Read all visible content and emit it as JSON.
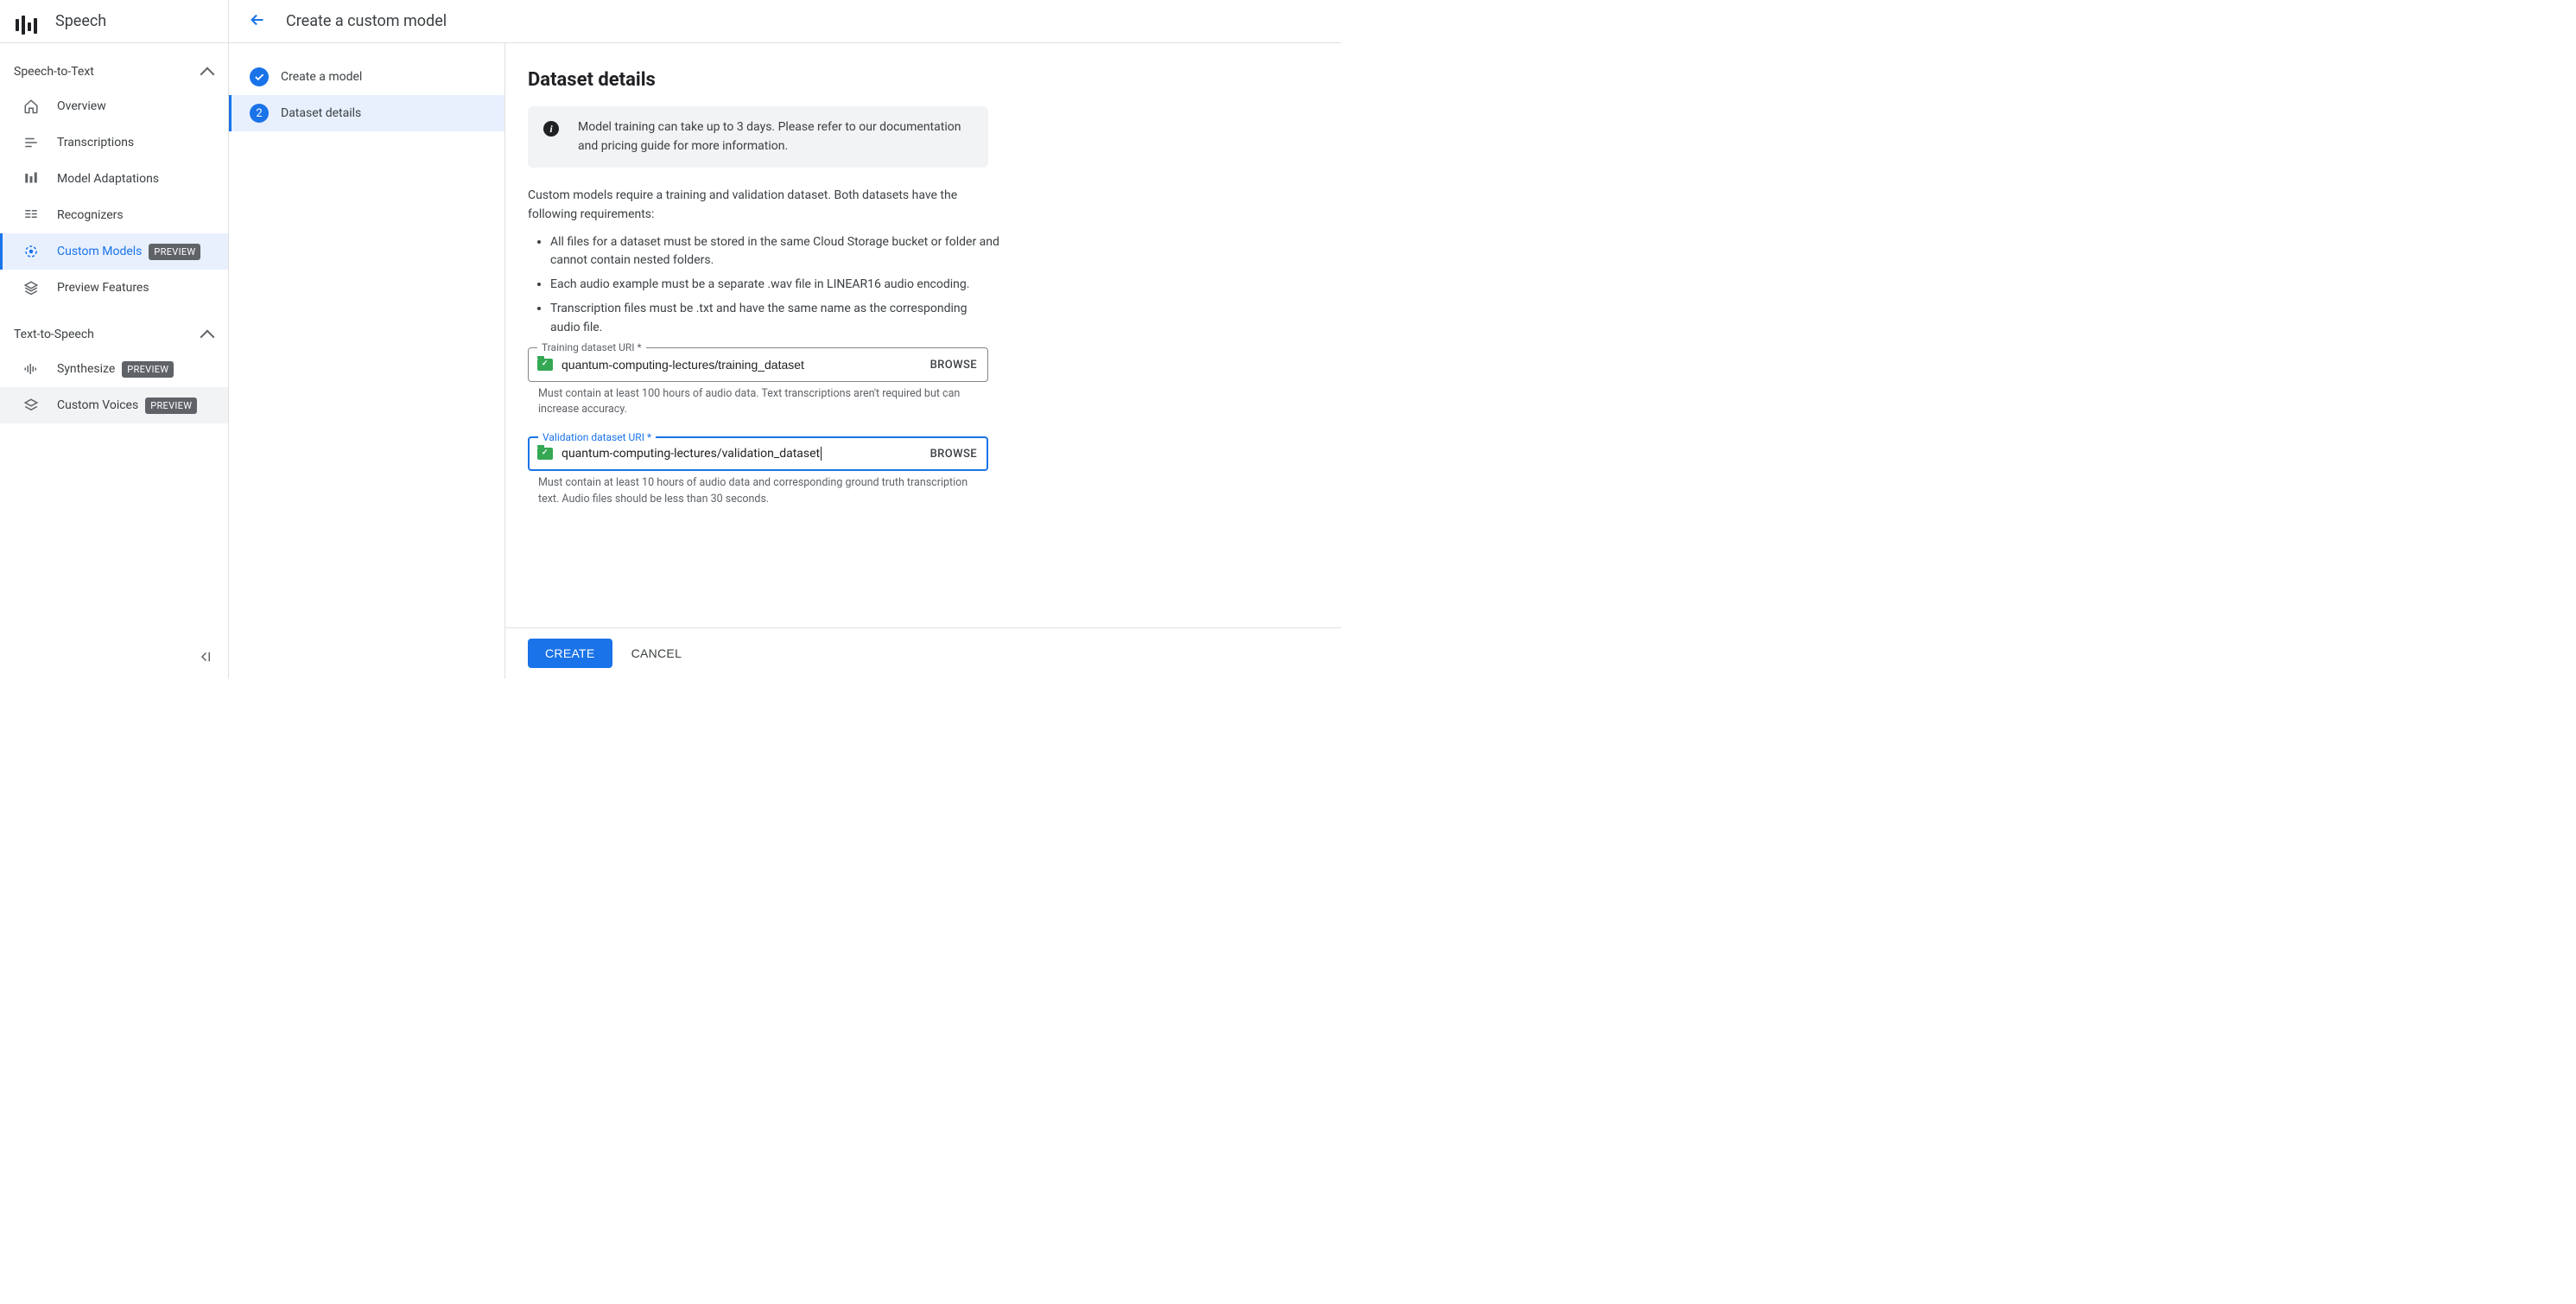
{
  "sidebar": {
    "title": "Speech",
    "sections": [
      {
        "label": "Speech-to-Text",
        "items": [
          {
            "label": "Overview",
            "icon": "home"
          },
          {
            "label": "Transcriptions",
            "icon": "transcriptions"
          },
          {
            "label": "Model Adaptations",
            "icon": "adaptations"
          },
          {
            "label": "Recognizers",
            "icon": "recognizers"
          },
          {
            "label": "Custom Models",
            "icon": "custom-models",
            "badge": "PREVIEW",
            "selected": true
          },
          {
            "label": "Preview Features",
            "icon": "preview"
          }
        ]
      },
      {
        "label": "Text-to-Speech",
        "items": [
          {
            "label": "Synthesize",
            "icon": "synthesize",
            "badge": "PREVIEW"
          },
          {
            "label": "Custom Voices",
            "icon": "voices",
            "badge": "PREVIEW",
            "hover": true
          }
        ]
      }
    ]
  },
  "header": {
    "title": "Create a custom model"
  },
  "stepper": {
    "steps": [
      {
        "label": "Create a model",
        "state": "done"
      },
      {
        "label": "Dataset details",
        "state": "active",
        "number": "2"
      }
    ]
  },
  "content": {
    "title": "Dataset details",
    "banner": "Model training can take up to 3 days. Please refer to our documentation and pricing guide for more information.",
    "intro": "Custom models require a training and validation dataset. Both datasets have the following requirements:",
    "requirements": [
      "All files for a dataset must be stored in the same Cloud Storage bucket or folder and cannot contain nested folders.",
      "Each audio example must be a separate .wav file in LINEAR16 audio encoding.",
      "Transcription files must be .txt and have the same name as the corresponding audio file."
    ],
    "training": {
      "label": "Training dataset URI *",
      "value": "quantum-computing-lectures/training_dataset",
      "browse": "BROWSE",
      "helper": "Must contain at least 100 hours of audio data. Text transcriptions aren't required but can increase accuracy."
    },
    "validation": {
      "label": "Validation dataset URI *",
      "value": "quantum-computing-lectures/validation_dataset",
      "browse": "BROWSE",
      "helper": "Must contain at least 10 hours of audio data and corresponding ground truth transcription text. Audio files should be less than 30 seconds."
    }
  },
  "actions": {
    "create": "CREATE",
    "cancel": "CANCEL"
  }
}
